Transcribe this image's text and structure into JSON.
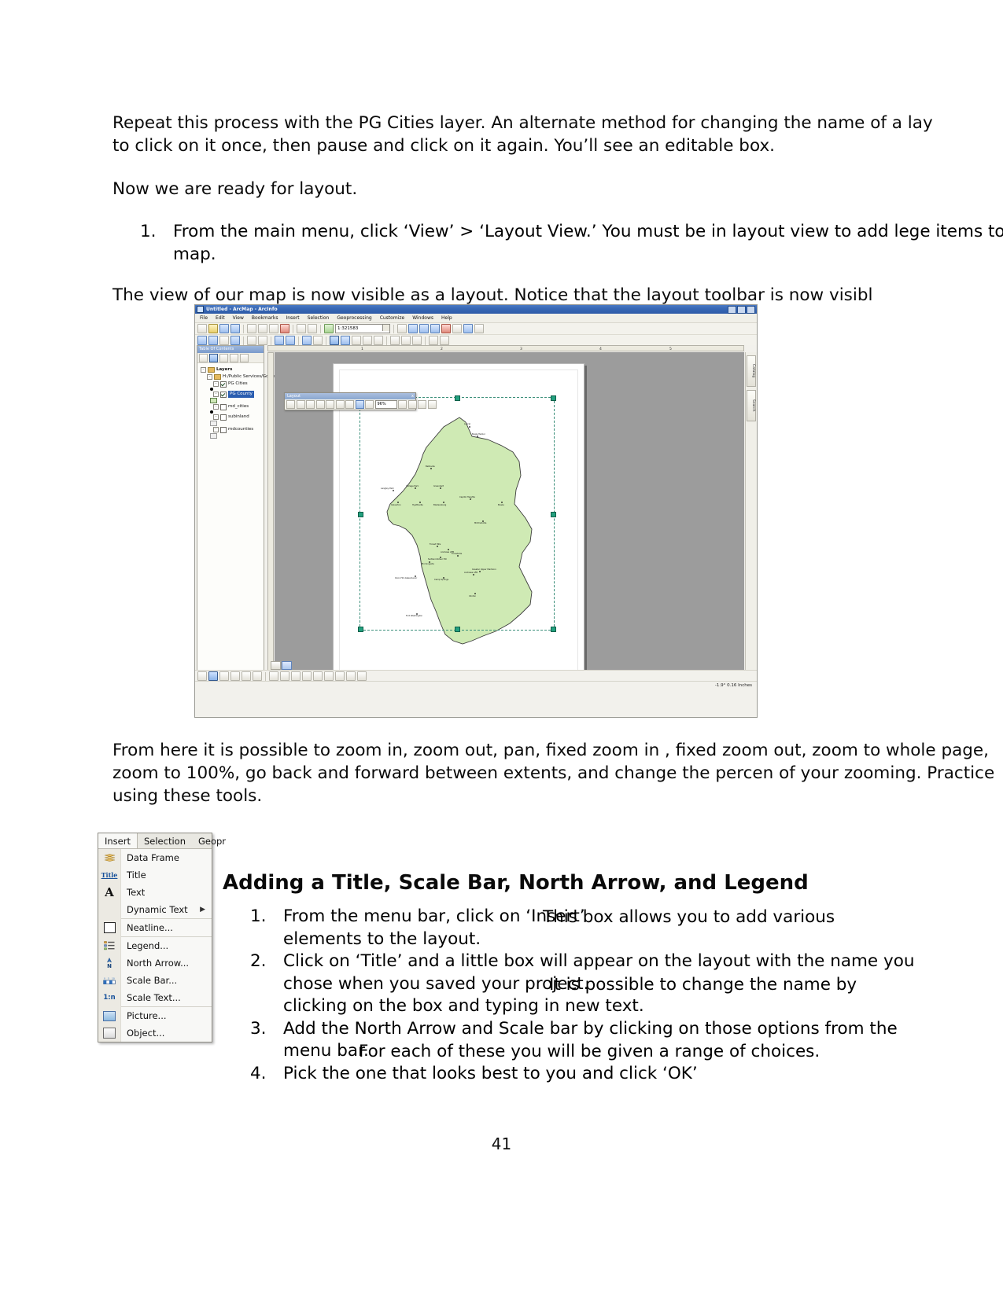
{
  "document": {
    "page_number": "41",
    "paragraphs": {
      "intro": "Repeat this process with the PG Cities layer.  An alternate method for changing the name of a lay to click on it once, then pause and click on it again.  You’ll see an editable box.",
      "intro_line1": "Repeat this process with the PG Cities layer.  An alternate method for changing the name of a lay",
      "intro_line2": "to click on it once, then pause and click on it again.  You’ll see an editable box.",
      "ready": "Now we are ready for layout.",
      "step1_number": "1.",
      "step1_text": "From the main menu, click ‘View’ > ‘Layout View.’  You must be in layout view to add lege items to your map.",
      "after_figure": "The view of our map is now visible as a layout. Notice that the layout toolbar is now visibl",
      "from_here": "From here it is possible to zoom in, zoom out, pan, fixed zoom in , fixed zoom out, zoom to whole page, zoom to 100%, go back and forward between extents, and change the percen of your zooming. Practice using these tools."
    },
    "section": {
      "heading": "Adding a Title, Scale Bar, North Arrow, and Legend",
      "items": [
        {
          "number": "1.",
          "text_a": "From the menu bar, click on ‘Insert’",
          "text_overlap": "This box allows you to add various",
          "text_b": "elements to the layout."
        },
        {
          "number": "2.",
          "text_a": "Click on ‘Title’ and a little box will appear on the layout with the name you",
          "text_b": "chose when you saved your project.",
          "text_overlap": "It is possible to change the name by",
          "text_c": "clicking on the box and typing in new text."
        },
        {
          "number": "3.",
          "text_a": "Add the North Arrow and Scale bar by clicking on those options from the",
          "text_b": "menu bar.",
          "text_overlap": "For each of these you will be given a range of choices."
        },
        {
          "number": "4.",
          "text_a": "Pick the one that looks best to you and click ‘OK’"
        }
      ]
    }
  },
  "insert_menu": {
    "tabs": [
      {
        "label": "Insert",
        "active": true
      },
      {
        "label": "Selection",
        "active": false
      },
      {
        "label": "Geopr",
        "active": false
      }
    ],
    "items": [
      {
        "label": "Data Frame",
        "icon": "data-frame-icon",
        "submenu": false
      },
      {
        "label": "Title",
        "icon": "title-icon",
        "submenu": false
      },
      {
        "label": "Text",
        "icon": "text-icon",
        "submenu": false
      },
      {
        "label": "Dynamic Text",
        "icon": "dynamic-text-icon",
        "submenu": true,
        "arrow": "▶"
      },
      {
        "label": "Neatline...",
        "icon": "neatline-icon",
        "submenu": false
      },
      {
        "label": "Legend...",
        "icon": "legend-icon",
        "submenu": false
      },
      {
        "label": "North Arrow...",
        "icon": "north-arrow-icon",
        "submenu": false
      },
      {
        "label": "Scale Bar...",
        "icon": "scale-bar-icon",
        "submenu": false
      },
      {
        "label": "Scale Text...",
        "icon": "scale-text-icon",
        "submenu": false
      },
      {
        "label": "Picture...",
        "icon": "picture-icon",
        "submenu": false
      },
      {
        "label": "Object...",
        "icon": "object-icon",
        "submenu": false
      }
    ],
    "scale_text_icon_label": "1:n",
    "title_icon_label": "Title",
    "text_icon_label": "A",
    "north_icon_label": "N"
  },
  "arcmap": {
    "window_title": "Untitled - ArcMap - ArcInfo",
    "menus": [
      "File",
      "Edit",
      "View",
      "Bookmarks",
      "Insert",
      "Selection",
      "Geoprocessing",
      "Customize",
      "Windows",
      "Help"
    ],
    "scale_value": "1:321583",
    "toc": {
      "header": "Table Of Contents",
      "root": "Layers",
      "nodes": [
        {
          "label": "H:/Public Services/Governm",
          "type": "folder",
          "indent": 1
        },
        {
          "label": "PG Cities",
          "type": "layer",
          "checked": true,
          "indent": 2,
          "selected": false
        },
        {
          "label": "PG County",
          "type": "layer",
          "checked": true,
          "indent": 2,
          "selected": true
        },
        {
          "label": "md_cities",
          "type": "layer",
          "checked": false,
          "indent": 2,
          "selected": false
        },
        {
          "label": "subinland",
          "type": "layer",
          "checked": false,
          "indent": 2,
          "selected": false
        },
        {
          "label": "mdcounties",
          "type": "layer",
          "checked": false,
          "indent": 2,
          "selected": false
        }
      ]
    },
    "layout_toolbar": {
      "title": "Layout",
      "close_label": "x",
      "zoom_percent": "96%"
    },
    "status_text": "-1.9° 0.16 Inches",
    "ruler_ticks": [
      "1",
      "2",
      "3",
      "4",
      "5"
    ],
    "map_labels": [
      "Laurel",
      "Eagle Harbor",
      "Beltsville",
      "Langley Park",
      "College Park",
      "Greenbelt",
      "Hyattsville",
      "Bladensburg",
      "Capitol Heights",
      "Bowie",
      "Upper Marlboro",
      "Mitchellville",
      "Forest Heights",
      "District Heights",
      "Morningside",
      "Suitland-Silver Hill",
      "Camp Springs",
      "Andrews AFB",
      "Oxon Hill-Glassmanor",
      "Clinton",
      "Fort Washington",
      "Greater Upper Marlboro"
    ]
  },
  "colors": {
    "title_bar_blue": "#3767b4",
    "map_fill_green": "#cfeab4",
    "selection_teal": "#24a07f",
    "toc_select_blue": "#2a5db0",
    "menu_bg": "#f8f8f6"
  }
}
